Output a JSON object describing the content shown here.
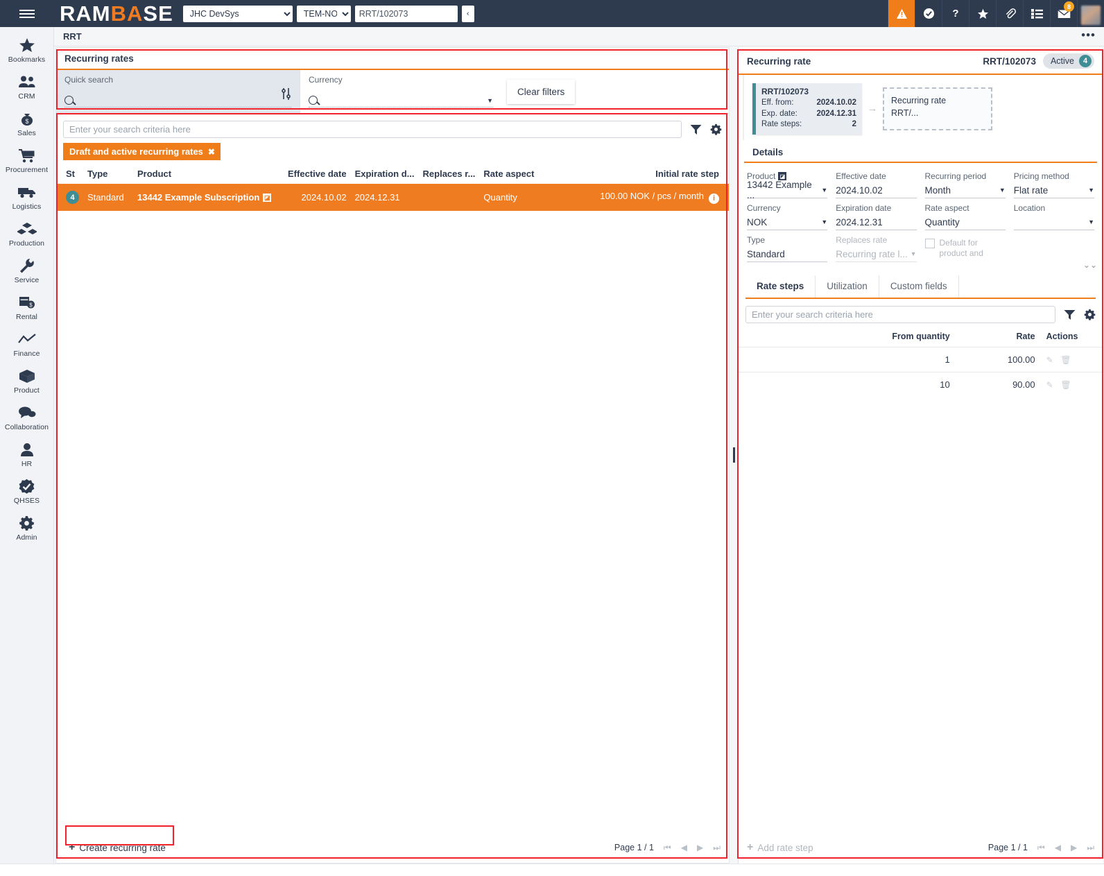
{
  "header": {
    "brand_left": "RAM",
    "brand_accent": "BA",
    "brand_right": "SE",
    "system_select": "JHC DevSys",
    "location_select": "TEM-NO",
    "doc_input": "RRT/102073",
    "collapse_label": "‹",
    "icons": [
      {
        "name": "warning-icon",
        "glyph": "⚠"
      },
      {
        "name": "approval-check-icon",
        "glyph": "✔"
      },
      {
        "name": "help-icon",
        "glyph": "?"
      },
      {
        "name": "favorites-star-icon",
        "glyph": "★"
      },
      {
        "name": "attachment-icon",
        "glyph": "✐"
      },
      {
        "name": "tasklist-icon",
        "glyph": "☰"
      },
      {
        "name": "messages-icon",
        "glyph": "✉",
        "badge": "8"
      }
    ]
  },
  "sidebar": {
    "items": [
      {
        "label": "Bookmarks",
        "icon": "star-icon"
      },
      {
        "label": "CRM",
        "icon": "people-icon"
      },
      {
        "label": "Sales",
        "icon": "money-bag-icon"
      },
      {
        "label": "Procurement",
        "icon": "shopping-cart-icon"
      },
      {
        "label": "Logistics",
        "icon": "truck-icon"
      },
      {
        "label": "Production",
        "icon": "boxes-icon"
      },
      {
        "label": "Service",
        "icon": "wrench-icon"
      },
      {
        "label": "Rental",
        "icon": "calendar-money-icon"
      },
      {
        "label": "Finance",
        "icon": "trend-line-icon"
      },
      {
        "label": "Product",
        "icon": "cube-icon"
      },
      {
        "label": "Collaboration",
        "icon": "chat-bubbles-icon"
      },
      {
        "label": "HR",
        "icon": "person-icon"
      },
      {
        "label": "QHSES",
        "icon": "check-badge-icon"
      },
      {
        "label": "Admin",
        "icon": "gear-icon"
      }
    ]
  },
  "breadcrumb": "RRT",
  "overflow_menu": "•••",
  "filters": {
    "title": "Recurring rates",
    "quick_search": {
      "label": "Quick search",
      "value": "",
      "placeholder": ""
    },
    "currency": {
      "label": "Currency",
      "value": "",
      "placeholder": ""
    },
    "clear_button": "Clear filters",
    "advanced_icon": "sliders-icon"
  },
  "list": {
    "search_placeholder": "Enter your search criteria here",
    "search_value": "",
    "filter_icon": "funnel-icon",
    "settings_icon": "gear-icon",
    "chip": "Draft and active recurring rates",
    "chip_close": "✖",
    "columns": [
      "St",
      "Type",
      "Product",
      "Effective date",
      "Expiration d...",
      "Replaces r...",
      "Rate aspect",
      "Initial rate step"
    ],
    "rows": [
      {
        "status": "4",
        "type": "Standard",
        "product": "13442 Example Subscription",
        "product_link_icon": "open-external-icon",
        "effective_date": "2024.10.02",
        "expiration_date": "2024.12.31",
        "replaces_rate": "",
        "rate_aspect": "Quantity",
        "initial_rate_step": "100.00 NOK / pcs / month",
        "info_icon": "info-icon"
      }
    ],
    "create_button": "Create recurring rate",
    "page_label": "Page 1 / 1"
  },
  "detail": {
    "panel_title": "Recurring rate",
    "record_id": "RRT/102073",
    "status_text": "Active",
    "status_number": "4",
    "flow": {
      "card": {
        "id": "RRT/102073",
        "rows": [
          {
            "label": "Eff. from:",
            "value": "2024.10.02"
          },
          {
            "label": "Exp. date:",
            "value": "2024.12.31"
          },
          {
            "label": "Rate steps:",
            "value": "2"
          }
        ]
      },
      "arrow": "→",
      "ghost": {
        "line1": "Recurring rate",
        "line2": "RRT/..."
      }
    },
    "details_title": "Details",
    "fields": [
      {
        "label": "Product",
        "value": "13442 Example ...",
        "dropdown": true,
        "external": true
      },
      {
        "label": "Effective date",
        "value": "2024.10.02",
        "dropdown": false
      },
      {
        "label": "Recurring period",
        "value": "Month",
        "dropdown": true
      },
      {
        "label": "Pricing method",
        "value": "Flat rate",
        "dropdown": true
      },
      {
        "label": "Currency",
        "value": "NOK",
        "dropdown": true
      },
      {
        "label": "Expiration date",
        "value": "2024.12.31",
        "dropdown": false
      },
      {
        "label": "Rate aspect",
        "value": "Quantity",
        "dropdown": false
      },
      {
        "label": "Location",
        "value": "",
        "dropdown": true
      },
      {
        "label": "Type",
        "value": "Standard",
        "dropdown": false
      },
      {
        "label": "Replaces rate",
        "value": "Recurring rate l...",
        "dropdown": true,
        "muted": true
      }
    ],
    "checkbox_field": {
      "label": "Default for product and",
      "checked": false
    },
    "collapse_icon": "chevron-double-down-icon",
    "tabs": [
      {
        "label": "Rate steps",
        "active": true
      },
      {
        "label": "Utilization",
        "active": false
      },
      {
        "label": "Custom fields",
        "active": false
      }
    ],
    "rate_steps": {
      "search_placeholder": "Enter your search criteria here",
      "search_value": "",
      "filter_icon": "funnel-icon",
      "settings_icon": "gear-icon",
      "columns": [
        "From quantity",
        "Rate",
        "Actions"
      ],
      "rows": [
        {
          "from_quantity": "1",
          "rate": "100.00",
          "edit_icon": "pencil-icon",
          "delete_icon": "trash-icon"
        },
        {
          "from_quantity": "10",
          "rate": "90.00",
          "edit_icon": "pencil-icon",
          "delete_icon": "trash-icon"
        }
      ],
      "add_button": "Add rate step",
      "page_label": "Page 1 / 1"
    }
  },
  "colors": {
    "brand_navy": "#2e3a4e",
    "accent_orange": "#ef7d1a",
    "status_teal": "#3f8e95",
    "highlight_red": "#f0222b"
  }
}
